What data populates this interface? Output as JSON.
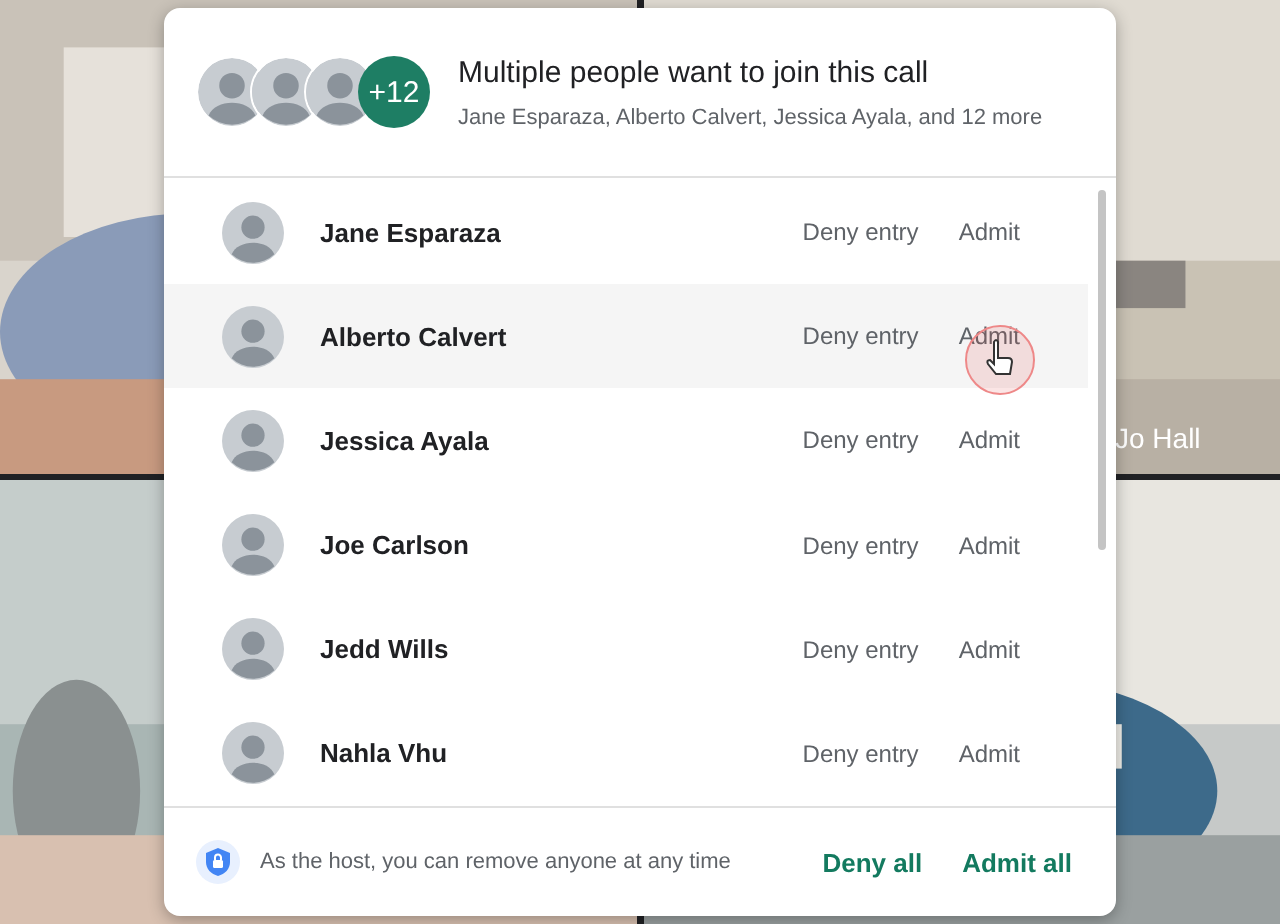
{
  "background": {
    "tile_label": "Jo Hall"
  },
  "dialog": {
    "header": {
      "more_badge": "+12",
      "title": "Multiple people want to join this call",
      "subtitle": "Jane Esparaza, Alberto Calvert, Jessica Ayala, and 12 more"
    },
    "requests": [
      {
        "name": "Jane Esparaza",
        "deny": "Deny entry",
        "admit": "Admit",
        "hovered": false
      },
      {
        "name": "Alberto Calvert",
        "deny": "Deny entry",
        "admit": "Admit",
        "hovered": true
      },
      {
        "name": "Jessica Ayala",
        "deny": "Deny entry",
        "admit": "Admit",
        "hovered": false
      },
      {
        "name": "Joe Carlson",
        "deny": "Deny entry",
        "admit": "Admit",
        "hovered": false
      },
      {
        "name": "Jedd Wills",
        "deny": "Deny entry",
        "admit": "Admit",
        "hovered": false
      },
      {
        "name": "Nahla Vhu",
        "deny": "Deny entry",
        "admit": "Admit",
        "hovered": false
      }
    ],
    "footer": {
      "note": "As the host, you can remove anyone at any time",
      "deny_all": "Deny all",
      "admit_all": "Admit all"
    }
  }
}
